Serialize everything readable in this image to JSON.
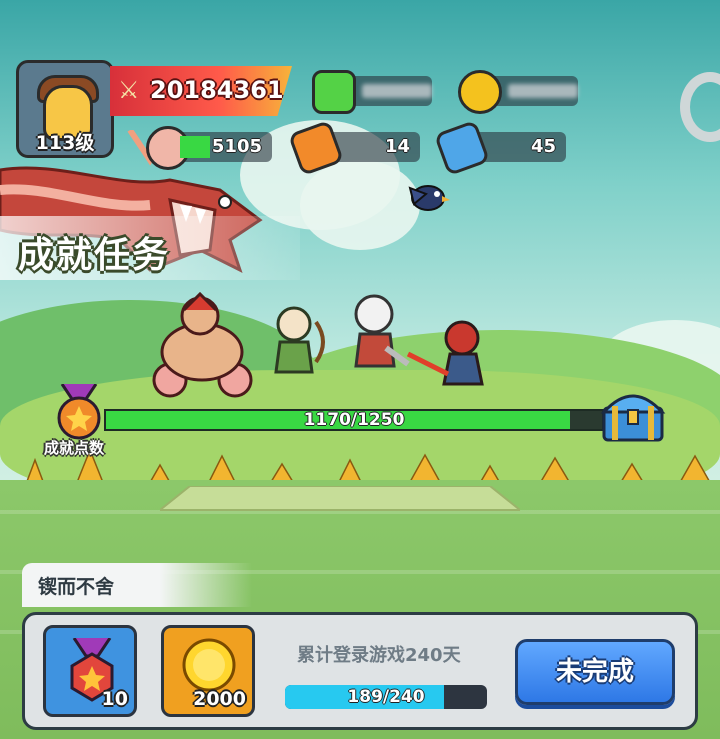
{
  "player": {
    "level_label": "113级",
    "combat_power": "20184361"
  },
  "resources": {
    "gems_value_obscured": "",
    "coins_value_obscured": "",
    "meat": "5105",
    "ticket_orange": "14",
    "ticket_blue": "45"
  },
  "page": {
    "title": "成就任务"
  },
  "achievement_points": {
    "label": "成就点数",
    "current": 1170,
    "max": 1250,
    "text": "1170/1250"
  },
  "task": {
    "category_tab": "锲而不舍",
    "description": "累计登录游戏240天",
    "progress_current": 189,
    "progress_max": 240,
    "progress_text": "189/240",
    "status_button": "未完成",
    "rewards": [
      {
        "type": "achievement-medal",
        "amount": "10"
      },
      {
        "type": "gold-coin",
        "amount": "2000"
      }
    ]
  },
  "colors": {
    "progress_green": "#39d843",
    "task_bar_blue": "#27c9f0",
    "button_blue": "#2e78e6",
    "power_red": "#d7303a"
  }
}
